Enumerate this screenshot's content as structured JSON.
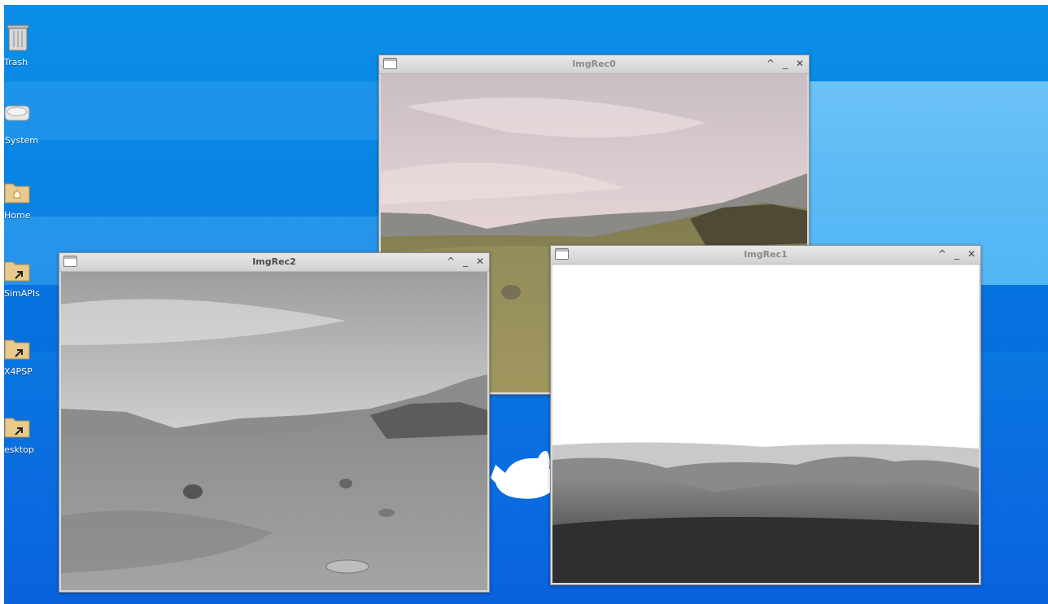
{
  "desktop_icons": [
    {
      "label": "Trash",
      "icon": "trash-icon"
    },
    {
      "label": "System",
      "icon": "drive-icon"
    },
    {
      "label": "Home",
      "icon": "home-folder-icon"
    },
    {
      "label": "SimAPIs",
      "icon": "folder-link-icon"
    },
    {
      "label": "X4PSP",
      "icon": "folder-link-icon"
    },
    {
      "label": "esktop",
      "icon": "folder-link-icon"
    }
  ],
  "windows": {
    "rec0": {
      "title": "ImgRec0"
    },
    "rec1": {
      "title": "ImgRec1"
    },
    "rec2": {
      "title": "ImgRec2"
    }
  },
  "controls": {
    "maximize": "^",
    "minimize": "_",
    "close": "✕"
  },
  "colors": {
    "desktop": "#0a7fe2",
    "titlebar": "#d9d9d9",
    "label": "#ffffff"
  }
}
